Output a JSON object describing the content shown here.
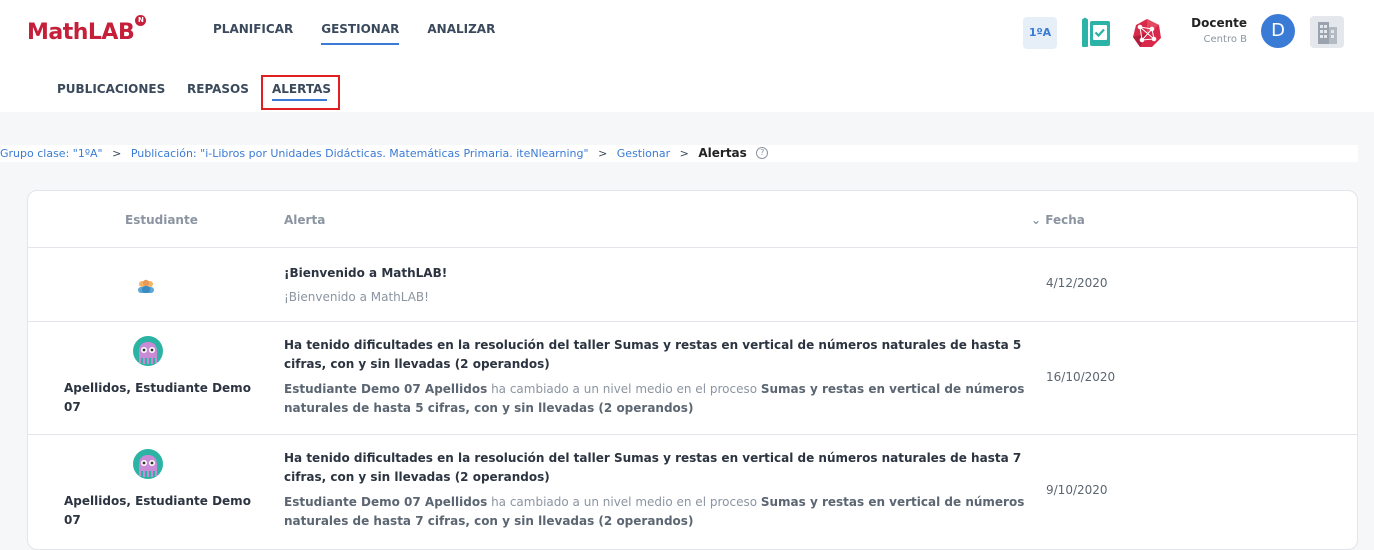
{
  "app": {
    "logo": "MathLAB",
    "logo_badge": "N",
    "colors": {
      "brand": "#c51f3a",
      "accent": "#3a7bd5",
      "highlight": "#e02020"
    }
  },
  "main_nav": [
    {
      "label": "PLANIFICAR"
    },
    {
      "label": "GESTIONAR"
    },
    {
      "label": "ANALIZAR"
    }
  ],
  "toolbar": {
    "group_badge": "1ºA",
    "book_icon": "book-check-icon",
    "network_icon": "network-icon",
    "user_name": "Docente",
    "user_center": "Centro B",
    "avatar_letter": "D",
    "building_icon": "building-icon"
  },
  "sub_nav": [
    {
      "label": "PUBLICACIONES"
    },
    {
      "label": "REPASOS"
    },
    {
      "label": "ALERTAS"
    }
  ],
  "breadcrumb": {
    "items": [
      "Grupo clase: \"1ºA\"",
      "Publicación: \"i-Libros por Unidades Didácticas. Matemáticas Primaria. iteNlearning\"",
      "Gestionar"
    ],
    "separator": ">",
    "current": "Alertas",
    "help": "?"
  },
  "table": {
    "headers": {
      "student": "Estudiante",
      "alert": "Alerta",
      "date": "Fecha"
    },
    "rows": [
      {
        "student": "",
        "title": "¡Bienvenido a MathLAB!",
        "message_plain": "¡Bienvenido a MathLAB!",
        "date": "4/12/2020"
      },
      {
        "student": "Apellidos, Estudiante Demo 07",
        "title": "Ha tenido dificultades en la resolución del taller Sumas y restas en vertical de números naturales de hasta 5 cifras, con y sin llevadas (2 operandos)",
        "msg_strong1": "Estudiante Demo 07 Apellidos",
        "msg_mid": " ha cambiado a un nivel medio en el proceso ",
        "msg_strong2": "Sumas y restas en vertical de números naturales de hasta 5 cifras, con y sin llevadas (2 operandos)",
        "date": "16/10/2020"
      },
      {
        "student": "Apellidos, Estudiante Demo 07",
        "title": "Ha tenido dificultades en la resolución del taller Sumas y restas en vertical de números naturales de hasta 7 cifras, con y sin llevadas (2 operandos)",
        "msg_strong1": "Estudiante Demo 07 Apellidos",
        "msg_mid": " ha cambiado a un nivel medio en el proceso ",
        "msg_strong2": "Sumas y restas en vertical de números naturales de hasta 7 cifras, con y sin llevadas (2 operandos)",
        "date": "9/10/2020"
      }
    ]
  }
}
